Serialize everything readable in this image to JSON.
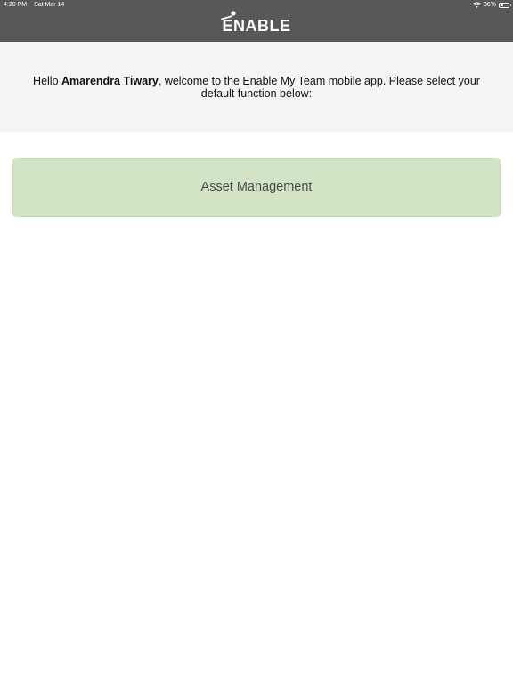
{
  "status_bar": {
    "time": "4:20 PM",
    "date": "Sat Mar 14",
    "battery": "36%",
    "battery_level": 0.36,
    "wifi_icon": "wifi-icon",
    "battery_icon": "battery-icon"
  },
  "header": {
    "logo_text": "ENABLE",
    "logo_icon": "enable-logo-mark-icon",
    "background_color": "#585858"
  },
  "welcome": {
    "greeting_prefix": "Hello ",
    "user_name": "Amarendra Tiwary",
    "message": ", welcome to the Enable My Team mobile app. Please select your default function below:"
  },
  "functions": [
    {
      "label": "Asset Management",
      "color": "#d2e4c4"
    }
  ]
}
